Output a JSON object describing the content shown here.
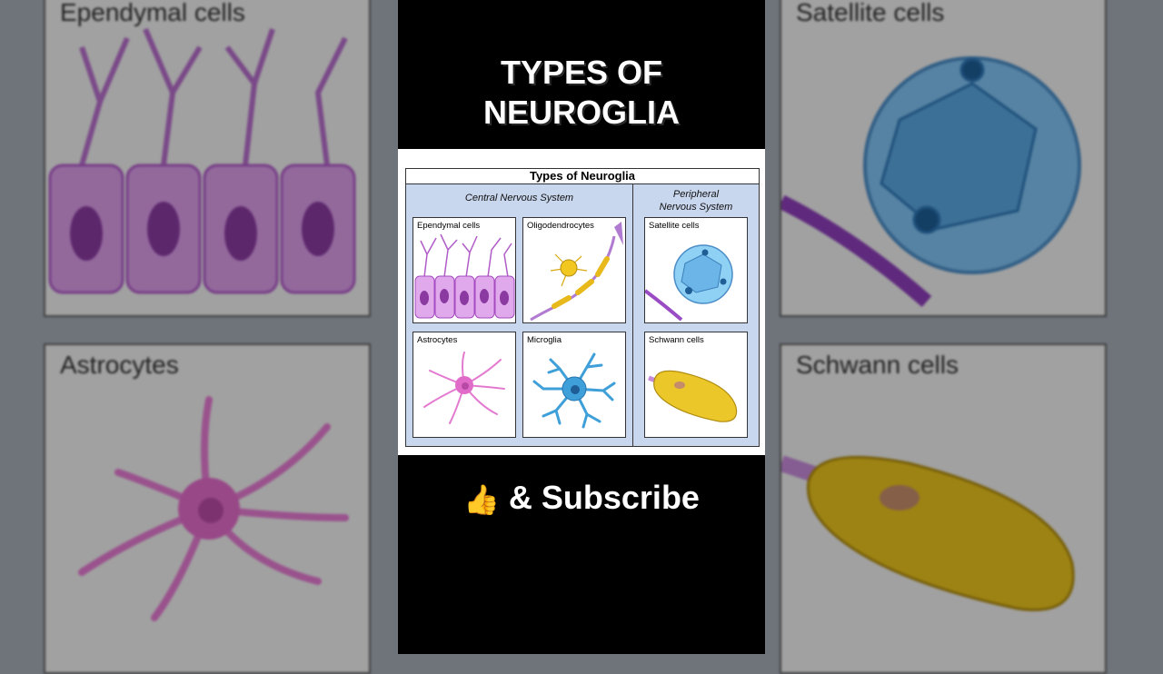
{
  "background": {
    "panels": {
      "ependymal": "Ependymal cells",
      "satellite": "Satellite cells",
      "astrocytes": "Astrocytes",
      "schwann": "Schwann cells"
    }
  },
  "header": {
    "title_line1": "TYPES OF",
    "title_line2": "NEUROGLIA"
  },
  "figure": {
    "title": "Types of Neuroglia",
    "cns_label": "Central Nervous System",
    "pns_label_line1": "Peripheral",
    "pns_label_line2": "Nervous System",
    "cells": {
      "ependymal": "Ependymal cells",
      "oligodendrocytes": "Oligodendrocytes",
      "satellite": "Satellite cells",
      "astrocytes": "Astrocytes",
      "microglia": "Microglia",
      "schwann": "Schwann cells"
    }
  },
  "footer": {
    "thumb_icon": "👍",
    "subscribe_text": "& Subscribe"
  },
  "colors": {
    "ependymal": "#c77ad6",
    "astrocyte": "#e47ad0",
    "microglia": "#3f9fd9",
    "satellite": "#7fc2f0",
    "schwann": "#e8c21c",
    "panel_bg": "#c8d6ee"
  }
}
